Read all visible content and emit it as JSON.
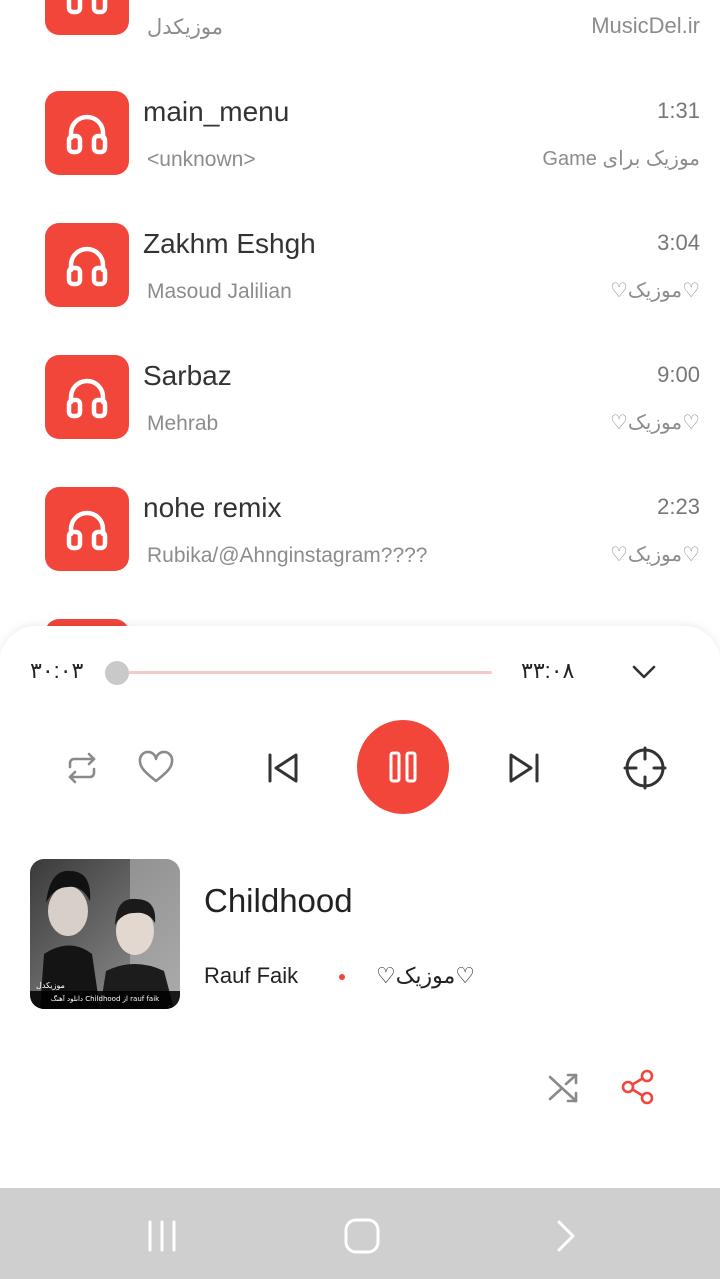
{
  "song_list": [
    {
      "title": "",
      "artist": "موزیکدل",
      "duration": "",
      "album": "MusicDel.ir"
    },
    {
      "title": "main_menu",
      "artist": "<unknown>",
      "duration": "1:31",
      "album": "موزیک برای Game"
    },
    {
      "title": "Zakhm Eshgh",
      "artist": "Masoud Jalilian",
      "duration": "3:04",
      "album": "♡موزیک♡"
    },
    {
      "title": "Sarbaz",
      "artist": "Mehrab",
      "duration": "9:00",
      "album": "♡موزیک♡"
    },
    {
      "title": "nohe remix",
      "artist": "Rubika/@Ahnginstagram????",
      "duration": "2:23",
      "album": "♡موزیک♡"
    }
  ],
  "player": {
    "elapsed": "۳۰:۰۳",
    "total": "۳۳:۰۸",
    "progress": 0.0,
    "now_playing": {
      "title": "Childhood",
      "artist": "Rauf Faik",
      "album": "♡موزیک♡",
      "art_caption_top": "موزیکدل",
      "art_caption_bottom": "دانلود آهنگ Childhood از rauf faik"
    },
    "state": "playing"
  },
  "icons": {
    "song_thumb": "headphones-icon",
    "repeat": "repeat-icon",
    "favorite": "heart-icon",
    "previous": "skip-previous-icon",
    "pause": "pause-icon",
    "next": "skip-next-icon",
    "locate": "crosshair-icon",
    "collapse": "chevron-down-icon",
    "shuffle": "shuffle-icon",
    "share": "share-icon"
  },
  "colors": {
    "accent": "#f2463b",
    "seek_track": "#f5c9c6",
    "nav_bar": "#cfcfcf"
  }
}
